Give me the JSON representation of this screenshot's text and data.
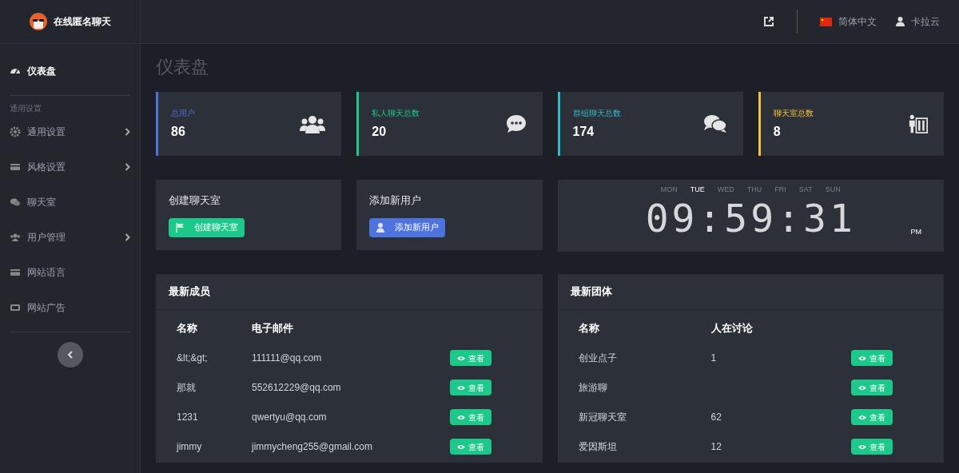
{
  "brand": {
    "name": "在线匿名聊天"
  },
  "header": {
    "language": "简体中文",
    "user": "卡拉云"
  },
  "sidebar": {
    "items": [
      {
        "label": "仪表盘",
        "kind": "gauge",
        "selected": true,
        "submenu": false
      }
    ],
    "section": "通用设置",
    "section_items": [
      {
        "label": "通用设置",
        "kind": "gear",
        "selected": false,
        "submenu": true
      },
      {
        "label": "风格设置",
        "kind": "card",
        "selected": false,
        "submenu": true
      },
      {
        "label": "聊天室",
        "kind": "chat",
        "selected": false,
        "submenu": false
      },
      {
        "label": "用户管理",
        "kind": "users",
        "selected": false,
        "submenu": true
      },
      {
        "label": "网站语言",
        "kind": "card",
        "selected": false,
        "submenu": false
      },
      {
        "label": "网站广告",
        "kind": "ad",
        "selected": false,
        "submenu": false
      }
    ]
  },
  "page_title": "仪表盘",
  "stats": [
    {
      "label": "总用户",
      "value": "86",
      "color": "#4e73df",
      "kind": "users"
    },
    {
      "label": "私人聊天总数",
      "value": "20",
      "color": "#1cc88a",
      "kind": "comment"
    },
    {
      "label": "群组聊天总数",
      "value": "174",
      "color": "#36b9cc",
      "kind": "comments"
    },
    {
      "label": "聊天室总数",
      "value": "8",
      "color": "#f6c23e",
      "kind": "building"
    }
  ],
  "actions": [
    {
      "title": "创建聊天室",
      "button": "创建聊天室",
      "color": "#1cc88a",
      "kind": "flag"
    },
    {
      "title": "添加新用户",
      "button": "添加新用户",
      "color": "#4e73df",
      "kind": "user"
    }
  ],
  "clock": {
    "days": [
      {
        "label": "MON",
        "selected": false
      },
      {
        "label": "TUE",
        "selected": true
      },
      {
        "label": "WED",
        "selected": false
      },
      {
        "label": "THU",
        "selected": false
      },
      {
        "label": "FRI",
        "selected": false
      },
      {
        "label": "SAT",
        "selected": false
      },
      {
        "label": "SUN",
        "selected": false
      }
    ],
    "time": "09:59:31",
    "meridiem": "PM"
  },
  "members": {
    "title": "最新成员",
    "columns": [
      "名称",
      "电子邮件"
    ],
    "rows": [
      {
        "name": "&lt;&gt;",
        "email": "111111@qq.com",
        "action": "查看"
      },
      {
        "name": "那就",
        "email": "552612229@qq.com",
        "action": "查看"
      },
      {
        "name": "1231",
        "email": "qwertyu@qq.com",
        "action": "查看"
      },
      {
        "name": "jimmy",
        "email": "jimmycheng255@gmail.com",
        "action": "查看"
      }
    ]
  },
  "groups": {
    "title": "最新团体",
    "columns": [
      "名称",
      "人在讨论"
    ],
    "rows": [
      {
        "name": "创业点子",
        "count": "1",
        "action": "查看"
      },
      {
        "name": "旅游聊",
        "action": "查看"
      },
      {
        "name": "新冠聊天室",
        "count": "62",
        "action": "查看"
      },
      {
        "name": "爱因斯坦",
        "count": "12",
        "action": "查看"
      }
    ]
  }
}
